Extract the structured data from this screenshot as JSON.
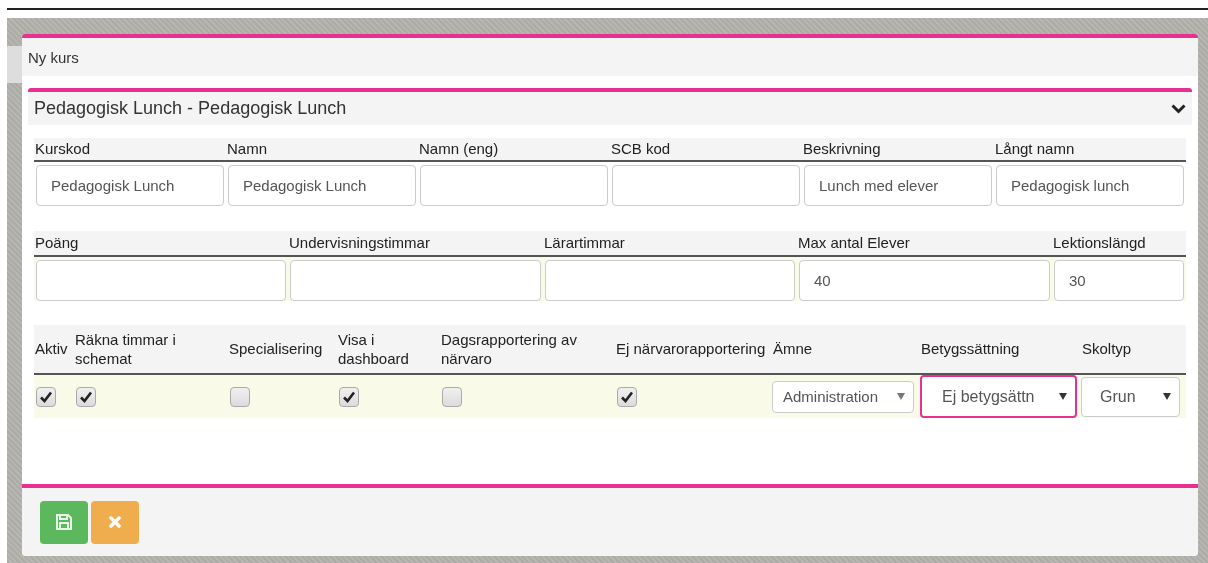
{
  "dialog": {
    "title": "Ny kurs"
  },
  "panel": {
    "title": "Pedagogisk Lunch - Pedagogisk Lunch",
    "expanded": true
  },
  "fields_row_1": [
    {
      "label": "Kurskod",
      "value": "Pedagogisk Lunch"
    },
    {
      "label": "Namn",
      "value": "Pedagogisk Lunch"
    },
    {
      "label": "Namn (eng)"
    },
    {
      "label": "SCB kod"
    },
    {
      "label": "Beskrivning",
      "value": "Lunch med elever"
    },
    {
      "label": "Långt namn",
      "value": "Pedagogisk lunch"
    }
  ],
  "fields_row_2": [
    {
      "label": "Poäng"
    },
    {
      "label": "Undervisningstimmar"
    },
    {
      "label": "Lärartimmar"
    },
    {
      "label": "Max antal Elever",
      "value": "40"
    },
    {
      "label": "Lektionslängd",
      "value": "30"
    }
  ],
  "options_row": [
    {
      "kind": "checkbox",
      "label": "Aktiv",
      "checked": true
    },
    {
      "kind": "checkbox",
      "label": "Räkna timmar i schemat",
      "checked": true
    },
    {
      "kind": "checkbox",
      "label": "Specialisering",
      "checked": false
    },
    {
      "kind": "checkbox",
      "label": "Visa i dashboard",
      "checked": true
    },
    {
      "kind": "checkbox",
      "label": "Dagsrapportering av närvaro",
      "checked": false
    },
    {
      "kind": "checkbox",
      "label": "Ej närvarorapportering",
      "checked": true
    },
    {
      "kind": "select",
      "label": "Ämne",
      "value": "Administration",
      "focused": false
    },
    {
      "kind": "select",
      "label": "Betygssättning",
      "value": "Ej betygsättn",
      "focused": true
    },
    {
      "kind": "select",
      "label": "Skoltyp",
      "value": "Grun",
      "focused": false
    }
  ],
  "buttons": [
    {
      "kind": "save"
    },
    {
      "kind": "cancel"
    }
  ]
}
